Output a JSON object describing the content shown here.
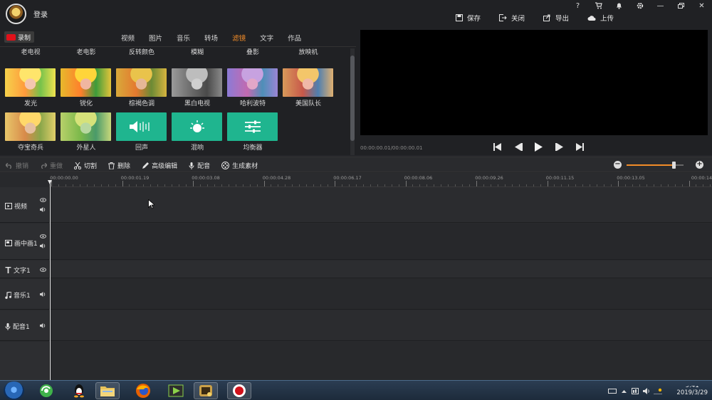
{
  "app": {
    "login_label": "登录"
  },
  "window_controls": [
    {
      "name": "help-icon",
      "glyph": "?"
    },
    {
      "name": "shop-icon",
      "glyph": ""
    },
    {
      "name": "notification-icon",
      "glyph": ""
    },
    {
      "name": "settings-icon",
      "glyph": ""
    },
    {
      "name": "minimize-icon",
      "glyph": "—"
    },
    {
      "name": "maximize-icon",
      "glyph": ""
    },
    {
      "name": "close-icon",
      "glyph": "✕"
    }
  ],
  "top_actions": {
    "save": "保存",
    "close": "关闭",
    "export": "导出",
    "upload": "上传"
  },
  "library": {
    "record_label": "录制",
    "tabs": [
      "视频",
      "图片",
      "音乐",
      "转场",
      "滤镜",
      "文字",
      "作品"
    ],
    "active_tab": "滤镜",
    "effects_row0": [
      "老电视",
      "老电影",
      "反转颜色",
      "模糊",
      "叠影",
      "放映机"
    ],
    "effects_row1": [
      "发光",
      "锐化",
      "棕褐色调",
      "黑白电视",
      "哈利波特",
      "美国队长"
    ],
    "effects_row2": [
      "夺宝奇兵",
      "外星人",
      "回声",
      "混响",
      "均衡器"
    ]
  },
  "preview": {
    "timecode": "00:00:00.01/00:00:00.01"
  },
  "toolbar": {
    "undo": "撤销",
    "redo": "重做",
    "split": "切割",
    "delete": "删除",
    "advanced_edit": "高级编辑",
    "dub": "配音",
    "generate": "生成素材",
    "zoom_level": 0.82
  },
  "timeline": {
    "ruler": [
      "00:00:00.00",
      "00:00:01.19",
      "00:00:03.08",
      "00:00:04.28",
      "00:00:06.17",
      "00:00:08.06",
      "00:00:09.26",
      "00:00:11.15",
      "00:00:13.05",
      "00:00:14"
    ],
    "tracks": {
      "video": "视频",
      "pip": "画中画1",
      "text": "文字1",
      "music": "音乐1",
      "voice": "配音1"
    }
  },
  "taskbar": {
    "clock_time": "9:41",
    "clock_date": "2019/3/29"
  },
  "colors": {
    "accent": "#f28c28",
    "record_red": "#e1111a",
    "audio_green": "#1fb58f"
  }
}
